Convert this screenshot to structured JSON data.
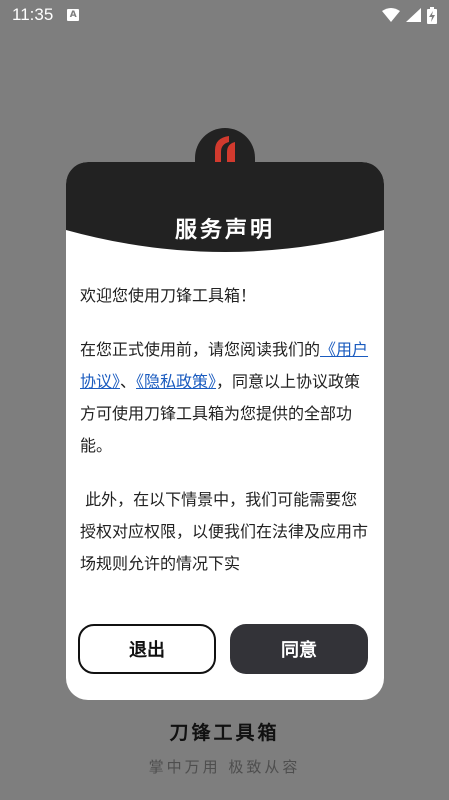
{
  "status_bar": {
    "time": "11:35",
    "notification_badge": "A",
    "icons": [
      "wifi-icon",
      "signal-icon",
      "battery-charging-icon"
    ]
  },
  "dialog": {
    "title": "服务声明",
    "greeting": "欢迎您使用刀锋工具箱！",
    "paragraph1_prefix": "在您正式使用前，请您阅读我们的",
    "user_agreement_link": "《用户协议》",
    "separator": "、",
    "privacy_policy_link": "《隐私政策》",
    "paragraph1_suffix": "，同意以上协议政策方可使用刀锋工具箱为您提供的全部功能。",
    "paragraph2": " 此外，在以下情景中，我们可能需要您授权对应权限，以便我们在法律及应用市场规则允许的情况下实",
    "exit_label": "退出",
    "agree_label": "同意"
  },
  "footer": {
    "app_name": "刀锋工具箱",
    "slogan": "掌中万用 极致从容"
  },
  "colors": {
    "overlay": "#7e7e7e",
    "header_dark": "#222222",
    "link_blue": "#1a5bbf",
    "button_dark": "#333338",
    "logo_red": "#d23a2e"
  }
}
